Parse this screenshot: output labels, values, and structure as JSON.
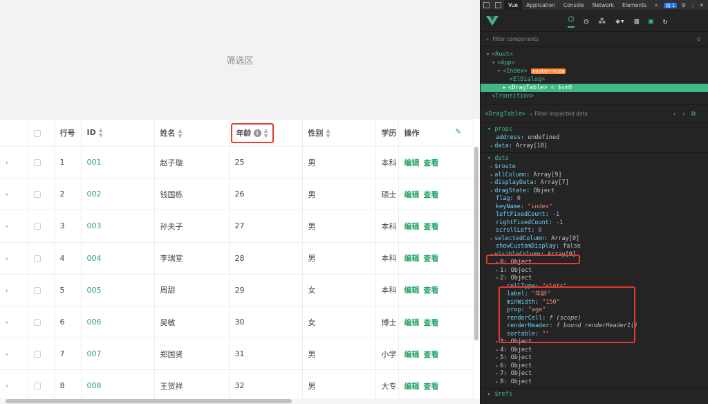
{
  "filter_area": {
    "label": "筛选区"
  },
  "table": {
    "headers": {
      "row_no": "行号",
      "id": "ID",
      "name": "姓名",
      "age": "年龄",
      "gender": "性别",
      "edu": "学历",
      "op": "操作"
    },
    "rows": [
      {
        "no": "1",
        "id": "001",
        "name": "赵子璇",
        "age": "25",
        "gender": "男",
        "edu": "本科"
      },
      {
        "no": "2",
        "id": "002",
        "name": "钱国栋",
        "age": "26",
        "gender": "男",
        "edu": "硕士"
      },
      {
        "no": "3",
        "id": "003",
        "name": "孙夫子",
        "age": "27",
        "gender": "男",
        "edu": "本科"
      },
      {
        "no": "4",
        "id": "004",
        "name": "李瑞堂",
        "age": "28",
        "gender": "男",
        "edu": "本科"
      },
      {
        "no": "5",
        "id": "005",
        "name": "周甜",
        "age": "29",
        "gender": "女",
        "edu": "本科"
      },
      {
        "no": "6",
        "id": "006",
        "name": "吴敏",
        "age": "30",
        "gender": "女",
        "edu": "博士"
      },
      {
        "no": "7",
        "id": "007",
        "name": "郑国贤",
        "age": "31",
        "gender": "男",
        "edu": "小学"
      },
      {
        "no": "8",
        "id": "008",
        "name": "王贺祥",
        "age": "32",
        "gender": "男",
        "edu": "大专"
      }
    ],
    "edit_label": "编辑",
    "view_label": "查看"
  },
  "devtools": {
    "tabs": [
      "Vue",
      "Application",
      "Console",
      "Network",
      "Elements",
      "»"
    ],
    "badge": "1",
    "filter_placeholder": "Filter components",
    "tree": {
      "root": "<Root>",
      "app": "<App>",
      "index": "<Index>",
      "router_tag": "router-view",
      "eldialog": "<ElDialog>",
      "dragtable": "<DragTable>",
      "vm": "= $vm0",
      "transition": "<Transition>"
    },
    "inspect": {
      "component": "<DragTable>",
      "placeholder": "Filter inspected data"
    },
    "props_title": "props",
    "props": [
      {
        "key": "address",
        "value": "undefined"
      },
      {
        "key": "data",
        "value": "Array[10]"
      }
    ],
    "data_title": "data",
    "data": [
      {
        "key": "$route",
        "value": ""
      },
      {
        "key": "allColumn",
        "value": "Array[9]"
      },
      {
        "key": "displayData",
        "value": "Array[7]"
      },
      {
        "key": "dragState",
        "value": "Object"
      },
      {
        "key": "flag",
        "value": "0"
      },
      {
        "key": "keyName",
        "value": "\"index\""
      },
      {
        "key": "leftFixedCount",
        "value": "-1"
      },
      {
        "key": "rightFixedCount",
        "value": "-1"
      },
      {
        "key": "scrollLeft",
        "value": "0"
      },
      {
        "key": "selectedColumn",
        "value": "Array[0]"
      },
      {
        "key": "showCustomDisplay",
        "value": "false"
      },
      {
        "key": "visibleColumn",
        "value": "Array[9]"
      },
      {
        "key": "0",
        "value": "Object"
      },
      {
        "key": "1",
        "value": "Object"
      },
      {
        "key": "2",
        "value": "Object"
      },
      {
        "key": "cellType",
        "value": "\"slots\""
      },
      {
        "key": "label",
        "value": "\"年龄\""
      },
      {
        "key": "minWidth",
        "value": "\"150\""
      },
      {
        "key": "prop",
        "value": "\"age\""
      },
      {
        "key": "renderCell",
        "value": "f (scope)"
      },
      {
        "key": "renderHeader",
        "value": "f bound renderHeader1()"
      },
      {
        "key": "sortable",
        "value": "\"\""
      },
      {
        "key": "3",
        "value": "Object"
      },
      {
        "key": "4",
        "value": "Object"
      },
      {
        "key": "5",
        "value": "Object"
      },
      {
        "key": "6",
        "value": "Object"
      },
      {
        "key": "7",
        "value": "Object"
      },
      {
        "key": "8",
        "value": "Object"
      }
    ],
    "refs_title": "$refs"
  }
}
